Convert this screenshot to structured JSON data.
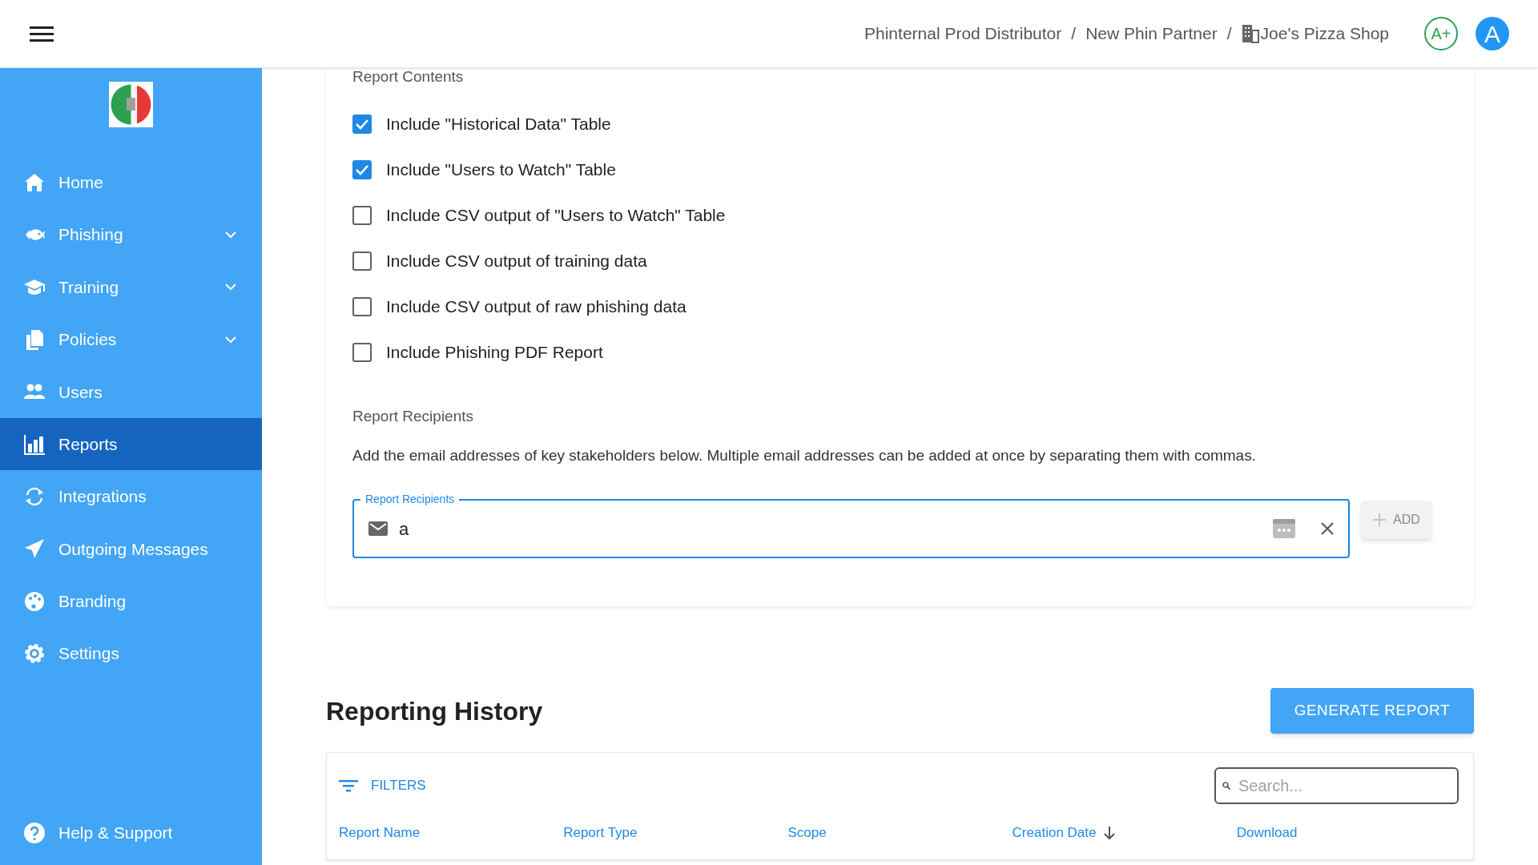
{
  "header": {
    "breadcrumbs": [
      {
        "label": "Phinternal Prod Distributor",
        "kind": "text"
      },
      {
        "label": "New Phin Partner",
        "kind": "text"
      },
      {
        "label": "Joe's Pizza Shop",
        "kind": "building"
      }
    ],
    "separators": [
      "/",
      "/"
    ],
    "score_badge": "A+",
    "avatar": "A"
  },
  "sidebar": {
    "items": [
      {
        "label": "Home",
        "kind": "home",
        "expandable": false,
        "selected": false
      },
      {
        "label": "Phishing",
        "kind": "fish",
        "expandable": true,
        "selected": false
      },
      {
        "label": "Training",
        "kind": "cap",
        "expandable": true,
        "selected": false
      },
      {
        "label": "Policies",
        "kind": "docs",
        "expandable": true,
        "selected": false
      },
      {
        "label": "Users",
        "kind": "users",
        "expandable": false,
        "selected": false
      },
      {
        "label": "Reports",
        "kind": "chart",
        "expandable": false,
        "selected": true
      },
      {
        "label": "Integrations",
        "kind": "sync",
        "expandable": false,
        "selected": false
      },
      {
        "label": "Outgoing Messages",
        "kind": "send",
        "expandable": false,
        "selected": false
      },
      {
        "label": "Branding",
        "kind": "palette",
        "expandable": false,
        "selected": false
      },
      {
        "label": "Settings",
        "kind": "gear",
        "expandable": false,
        "selected": false
      }
    ],
    "footer": "Help & Support"
  },
  "report_contents": {
    "title": "Report Contents",
    "options": [
      {
        "label": "Include \"Historical Data\" Table",
        "checked": true
      },
      {
        "label": "Include \"Users to Watch\" Table",
        "checked": true
      },
      {
        "label": "Include CSV output of \"Users to Watch\" Table",
        "checked": false
      },
      {
        "label": "Include CSV output of training data",
        "checked": false
      },
      {
        "label": "Include CSV output of raw phishing data",
        "checked": false
      },
      {
        "label": "Include Phishing PDF Report",
        "checked": false
      }
    ]
  },
  "recipients": {
    "title": "Report Recipients",
    "description": "Add the email addresses of key stakeholders below. Multiple email addresses can be added at once by separating them with commas.",
    "field": {
      "label": "Report Recipients",
      "value": "a"
    },
    "add_button": {
      "label": "ADD",
      "disabled": true
    }
  },
  "history": {
    "title": "Reporting History",
    "generate_button": "GENERATE REPORT",
    "filters": "FILTERS",
    "search_placeholder": "Search...",
    "columns": [
      {
        "label": "Report Name",
        "sorted": false
      },
      {
        "label": "Report Type",
        "sorted": false
      },
      {
        "label": "Scope",
        "sorted": false
      },
      {
        "label": "Creation Date",
        "sorted": true
      },
      {
        "label": "Download",
        "sorted": false
      }
    ]
  }
}
